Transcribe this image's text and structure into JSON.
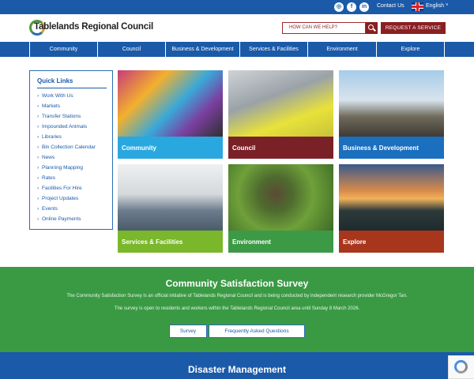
{
  "topbar": {
    "social": [
      "instagram-icon",
      "facebook-icon",
      "linkedin-icon"
    ],
    "social_glyphs": [
      "◎",
      "f",
      "in"
    ],
    "contact_label": "Contact Us",
    "language_label": "English"
  },
  "header": {
    "logo_text": "Tablelands Regional Council",
    "search_placeholder": "HOW CAN WE HELP?",
    "request_label": "REQUEST A SERVICE"
  },
  "nav": {
    "items": [
      "Community",
      "Council",
      "Business & Development",
      "Services & Facilities",
      "Environment",
      "Explore"
    ]
  },
  "quick_links": {
    "title": "Quick Links",
    "items": [
      "Work With Us",
      "Markets",
      "Transfer Stations",
      "Impounded Animals",
      "Libraries",
      "Bin Collection Calendar",
      "News",
      "Planning Mapping",
      "Rates",
      "Facilities For Hire",
      "Project Updates",
      "Events",
      "Online Payments"
    ]
  },
  "tiles": [
    {
      "label": "Community",
      "color": "#29a8e0"
    },
    {
      "label": "Council",
      "color": "#7a2128"
    },
    {
      "label": "Business & Development",
      "color": "#1a6fbf"
    },
    {
      "label": "Services & Facilities",
      "color": "#7ab72a"
    },
    {
      "label": "Environment",
      "color": "#3c9a46"
    },
    {
      "label": "Explore",
      "color": "#a8361d"
    }
  ],
  "survey": {
    "title": "Community Satisfaction Survey",
    "p1": "The Community Satisfaction Survey is an official initiative of Tablelands Regional Council and is being conducted by independent research provider McGregor Tan.",
    "p2": "The survey is open to residents and workers within the Tablelands Regional Council area until Sunday 8 March 2026.",
    "btn_survey": "Survey",
    "btn_faq": "Frequently Asked Questions"
  },
  "disaster": {
    "title": "Disaster Management"
  },
  "colors": {
    "primary_blue": "#1a5aa8",
    "maroon": "#8a1f24",
    "green": "#3a9a44"
  }
}
